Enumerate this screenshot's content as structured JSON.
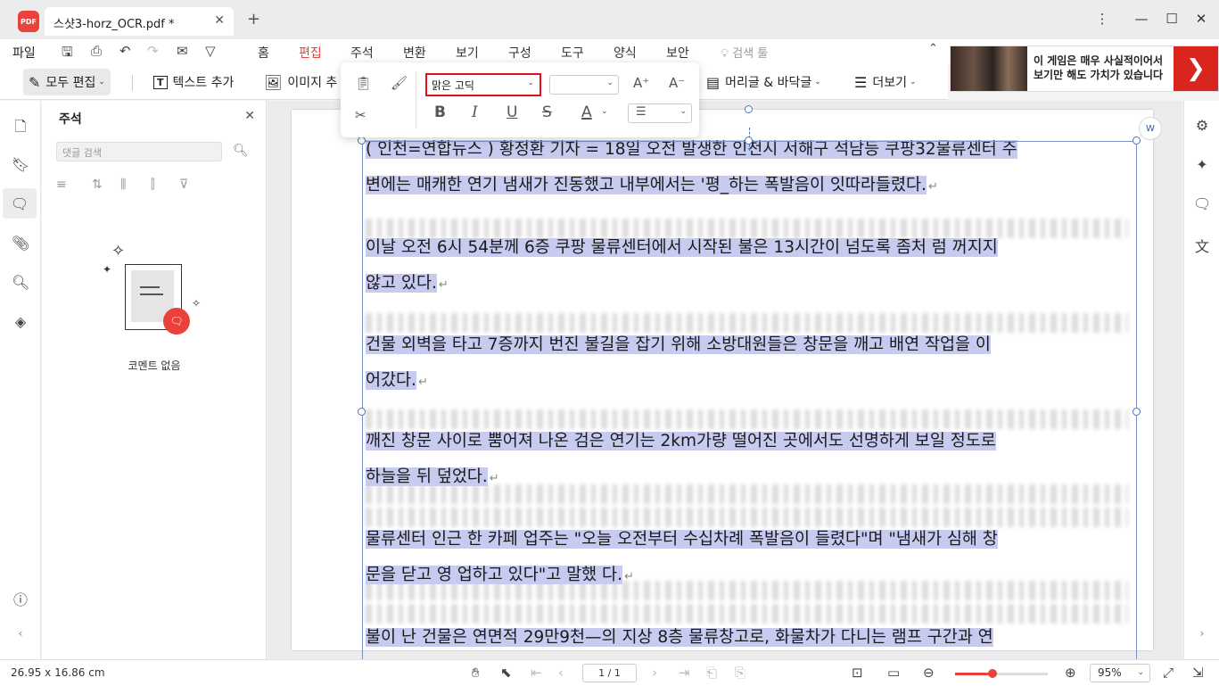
{
  "app": {
    "logo_text": "PDF",
    "tab_title": "스샷3-horz_OCR.pdf *",
    "tab_close": "✕",
    "new_tab": "+"
  },
  "window_controls": {
    "menu": "⋮",
    "minimize": "—",
    "maximize": "☐",
    "close": "✕"
  },
  "menubar": {
    "file_label": "파일",
    "tabs": [
      "홈",
      "편집",
      "주석",
      "변환",
      "보기",
      "구성",
      "도구",
      "양식",
      "보안"
    ],
    "active_tab": "편집",
    "search_label": "검색 툴"
  },
  "ad": {
    "text": "이 게임은 매우 사실적이어서 보기만 해도 가치가 있습니다",
    "arrow": "❯"
  },
  "toolbar": {
    "edit_all": "모두 편집",
    "add_text": "텍스트 추가",
    "add_image": "이미지 추",
    "header_footer": "머리글 & 바닥글",
    "more": "더보기"
  },
  "format_bar": {
    "font_name": "맑은 고딕"
  },
  "comment_panel": {
    "title": "주석",
    "search_placeholder": "댓글 검색",
    "empty_text": "코멘트 없음"
  },
  "document": {
    "paragraphs": [
      {
        "lines": [
          "( 인천=연합뉴스 )  황정환 기자 = 18일 오전 발생한 인천시 서해구 석남등 쿠팡32물류센터 주",
          "변에는 매캐한 연기 냄새가 진동했고 내부에서는 '평_하는 폭발음이 잇따라들렸다."
        ]
      },
      {
        "lines": [
          "이날 오전 6시 54분께 6증 쿠팡 물류센터에서 시작된 불은 13시간이 넘도록 좀처 럼 꺼지지",
          "않고 있다."
        ]
      },
      {
        "lines": [
          "건물 외벽을 타고 7증까지 번진 불길을 잡기 위해 소방대원들은 창문을 깨고 배연 작업을 이",
          "어갔다."
        ]
      },
      {
        "lines": [
          "깨진 창문 사이로 뿜어져 나온 검은 연기는 2km가량 떨어진 곳에서도 선명하게 보일 정도로",
          "하늘을 뒤 덮었다."
        ]
      },
      {
        "lines": [
          "물류센터 인근 한 카페 업주는 \"오늘 오전부터 수십차례 폭발음이 들렸다\"며 \"냄새가 심해 창",
          "문을 닫고 영 업하고 있다\"고 말했 다."
        ]
      },
      {
        "lines": [
          "불이 난 건물은 연면적 29만9천—의 지상 8층 물류창고로, 화물차가 다니는 램프 구간과 연"
        ]
      }
    ],
    "paragraph_mark": "↵"
  },
  "statusbar": {
    "page_size": "26.95 x 16.86 cm",
    "page_indicator": "1 / 1",
    "zoom_percent": 95,
    "zoom_label": "95%"
  }
}
